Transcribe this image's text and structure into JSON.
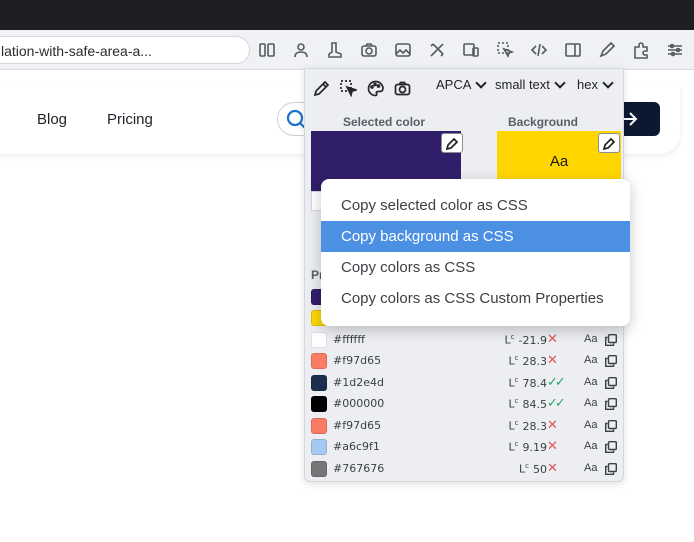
{
  "browser": {
    "url_text": "lation-with-safe-area-a...",
    "toolbar_icons": [
      "sidebar-icon",
      "person-icon",
      "boot-icon",
      "camera-icon",
      "image-icon",
      "tools-icon",
      "devices-icon",
      "pointer-icon",
      "code-icon",
      "panel-icon",
      "pencil-icon",
      "puzzle-icon",
      "sliders-icon"
    ]
  },
  "page": {
    "nav": {
      "blog": "Blog",
      "pricing": "Pricing"
    },
    "cta_arrow": "→"
  },
  "panel": {
    "tools": [
      "eyedropper-icon",
      "element-picker-icon",
      "palette-icon",
      "camera-icon"
    ],
    "selects": {
      "algorithm": "APCA",
      "size": "small text",
      "format": "hex"
    },
    "labels": {
      "selected": "Selected color",
      "background": "Background",
      "palette": "Pr"
    },
    "selected_color": "#311e6a",
    "background_color": "#ffd600",
    "background_sample": "Aa",
    "palette": [
      {
        "hex": "#ffffff",
        "lc": "-21.9",
        "pass": false,
        "color": "#ffffff"
      },
      {
        "hex": "#f97d65",
        "lc": "28.3",
        "pass": false,
        "color": "#f97d65"
      },
      {
        "hex": "#1d2e4d",
        "lc": "78.4",
        "pass": true,
        "color": "#1d2e4d"
      },
      {
        "hex": "#000000",
        "lc": "84.5",
        "pass": true,
        "color": "#000000"
      },
      {
        "hex": "#f97d65",
        "lc": "28.3",
        "pass": false,
        "color": "#f97d65"
      },
      {
        "hex": "#a6c9f1",
        "lc": "9.19",
        "pass": false,
        "color": "#a6c9f1"
      },
      {
        "hex": "#767676",
        "lc": "50",
        "pass": false,
        "color": "#767676"
      }
    ],
    "hidden_rows": [
      {
        "color": "#311e6a"
      },
      {
        "color": "#ffd600"
      }
    ],
    "aa_label": "Aa",
    "lc_prefix": "L",
    "lc_sup": "c"
  },
  "context_menu": {
    "items": [
      "Copy selected color as CSS",
      "Copy background as CSS",
      "Copy colors as CSS",
      "Copy colors as CSS Custom Properties"
    ],
    "active_index": 1
  }
}
